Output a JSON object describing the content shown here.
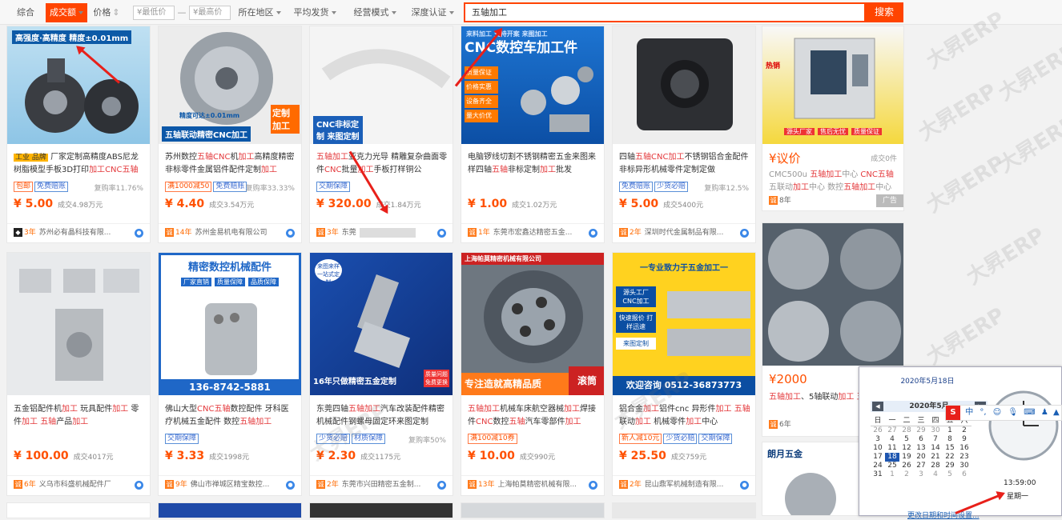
{
  "filter": {
    "items": [
      "综合",
      "成交额",
      "价格",
      "所在地区",
      "平均发货",
      "经营模式",
      "深度认证"
    ],
    "min_price": "¥最低价",
    "dash": "—",
    "max_price": "¥最高价",
    "search_value": "五轴加工",
    "search_button": "搜索"
  },
  "products": [
    {
      "img_text": "高强度·高精度 精度±0.01mm",
      "title": "厂家定制高精度ABS尼龙树脂模型手板3D打印加工CNC五轴实",
      "title_hl": "",
      "tags": [
        "包邮",
        "免费赔账"
      ],
      "rate": "复购率11.76%",
      "price": "¥ 5.00",
      "deal": "成交4.98万元",
      "years": "3年",
      "shop": "苏州必有晶科技有限...",
      "prefix": "工业 品牌"
    },
    {
      "img_text": "五轴联动精密CNC加工",
      "title": "苏州数控五轴CNC机加工高精度精密非标零件金属铝件配件定制加工",
      "tags": [
        "满1000减50",
        "免费赔账"
      ],
      "rate": "复购率33.33%",
      "price": "¥ 4.40",
      "deal": "成交3.54万元",
      "years": "14年",
      "shop": "苏州金易机电有限公司",
      "img_sub": "定制加工",
      "img_small": "精度可达±0.01mm"
    },
    {
      "img_text": "CNC非标定制 来图定制 五轴加工",
      "title": "五轴加工亚克力光导 精雕复杂曲面零件CNC批量加工手板打样铜公",
      "tags": [
        "交期保障"
      ],
      "rate": "",
      "price": "¥ 320.00",
      "deal": "成交1.84万元",
      "years": "3年",
      "shop": "东莞"
    },
    {
      "img_text": "CNC数控车加工件",
      "title": "电脑锣线切割不锈钢精密五金来图来样四轴五轴非标定制加工批发",
      "tags": [],
      "rate": "",
      "price": "¥ 1.00",
      "deal": "成交1.02万元",
      "years": "1年",
      "shop": "东莞市宏鑫达精密五金...",
      "img_small": "来料加工 支持开案 来图加工",
      "img_badges": [
        "质量保证",
        "价格实惠",
        "设备齐全",
        "量大价优"
      ]
    },
    {
      "img_text": "",
      "title": "四轴五轴CNC加工不锈钢铝合金配件 非标异形机械零件定制定做",
      "tags": [
        "免费赔账",
        "少货必赔"
      ],
      "rate": "复购率12.5%",
      "price": "¥ 5.00",
      "deal": "成交5400元",
      "years": "2年",
      "shop": "深圳时代金属制品有限..."
    },
    {
      "img_text": "",
      "title": "CMC500u 五轴加工中心 CNC五轴五联动加工中心 数控五轴加工中心",
      "tags": [],
      "rate": "",
      "price": "¥议价",
      "deal": "成交0件",
      "years": "8年",
      "shop": "广告",
      "img_small": "热销",
      "img_badges": [
        "源头厂家",
        "售后无忧",
        "质量保证"
      ]
    },
    {
      "img_text": "",
      "title": "五金铝配件机加工 玩具配件加工 零件加工 五轴产品加工",
      "tags": [],
      "rate": "",
      "price": "¥ 100.00",
      "deal": "成交4017元",
      "years": "6年",
      "shop": "义乌市科盛机械配件厂"
    },
    {
      "img_text": "精密数控机械配件",
      "title": "佛山大型CNC五轴数控配件 牙科医疗机械五金配件 数控五轴加工",
      "tags": [
        "交期保障"
      ],
      "rate": "",
      "price": "¥ 3.33",
      "deal": "成交1998元",
      "years": "9年",
      "shop": "佛山市禅城区精宝数控...",
      "img_phone": "136-8742-5881",
      "img_badges": [
        "厂家直销",
        "质量保障",
        "品质保障"
      ]
    },
    {
      "img_text": "16年只做精密五金定制",
      "title": "东莞四轴五轴加工汽车改装配件精密机械配件钢螺母固定环来图定制",
      "tags": [
        "少货必赔",
        "材质保障"
      ],
      "rate": "复购率50%",
      "price": "¥ 2.30",
      "deal": "成交1175元",
      "years": "2年",
      "shop": "东莞市兴田精密五金制...",
      "img_small": "来图来样 一站式定制",
      "img_badges": [
        "质量问题",
        "免费更换"
      ]
    },
    {
      "img_text": "专注造就高精品质",
      "title": "五轴加工机械车床航空器械加工焊接件CNC数控五轴汽车零部件加工",
      "tags": [
        "满100减10券"
      ],
      "rate": "",
      "price": "¥ 10.00",
      "deal": "成交990元",
      "years": "13年",
      "shop": "上海帕莫精密机械有限...",
      "img_top": "上海帕莫精密机械有限公司",
      "img_side": "滚筒"
    },
    {
      "img_text": "欢迎咨询 0512-36873773",
      "title": "铝合金加工铝件cnc 异形件加工 五轴联动加工 机械零件加工中心",
      "tags": [
        "新人减10元",
        "少货必赔",
        "交期保障"
      ],
      "rate": "",
      "price": "¥ 25.50",
      "deal": "成交759元",
      "years": "2年",
      "shop": "昆山鼎军机械制造有限...",
      "img_top": "一专业致力于五金加工一",
      "img_small": "源头工厂 CNC加工",
      "img_badges": [
        "快速报价 打样迅速",
        "来图定制"
      ]
    },
    {
      "img_text": "",
      "title": "五轴加工、5轴联动加工 五轴加工",
      "tags": [],
      "rate": "",
      "price": "¥2000",
      "deal": "",
      "years": "6年",
      "shop": "",
      "img_small": "朗月五金"
    }
  ],
  "clock": {
    "date_title": "2020年5月18日",
    "month": "2020年5月",
    "weekdays": [
      "日",
      "一",
      "二",
      "三",
      "四",
      "五",
      "六"
    ],
    "rows": [
      [
        "26",
        "27",
        "28",
        "29",
        "30",
        "1",
        "2"
      ],
      [
        "3",
        "4",
        "5",
        "6",
        "7",
        "8",
        "9"
      ],
      [
        "10",
        "11",
        "12",
        "13",
        "14",
        "15",
        "16"
      ],
      [
        "17",
        "18",
        "19",
        "20",
        "21",
        "22",
        "23"
      ],
      [
        "24",
        "25",
        "26",
        "27",
        "28",
        "29",
        "30"
      ],
      [
        "31",
        "1",
        "2",
        "3",
        "4",
        "5",
        "6"
      ]
    ],
    "time": "13:59:00",
    "weekday": "星期一",
    "link": "更改日期和时间设置...",
    "ime": "中"
  },
  "watermark": "大昇ERP",
  "colors": {
    "accent": "#ff4400",
    "price": "#ff5000",
    "highlight": "#e4393c",
    "arrow": "#e8201a"
  }
}
